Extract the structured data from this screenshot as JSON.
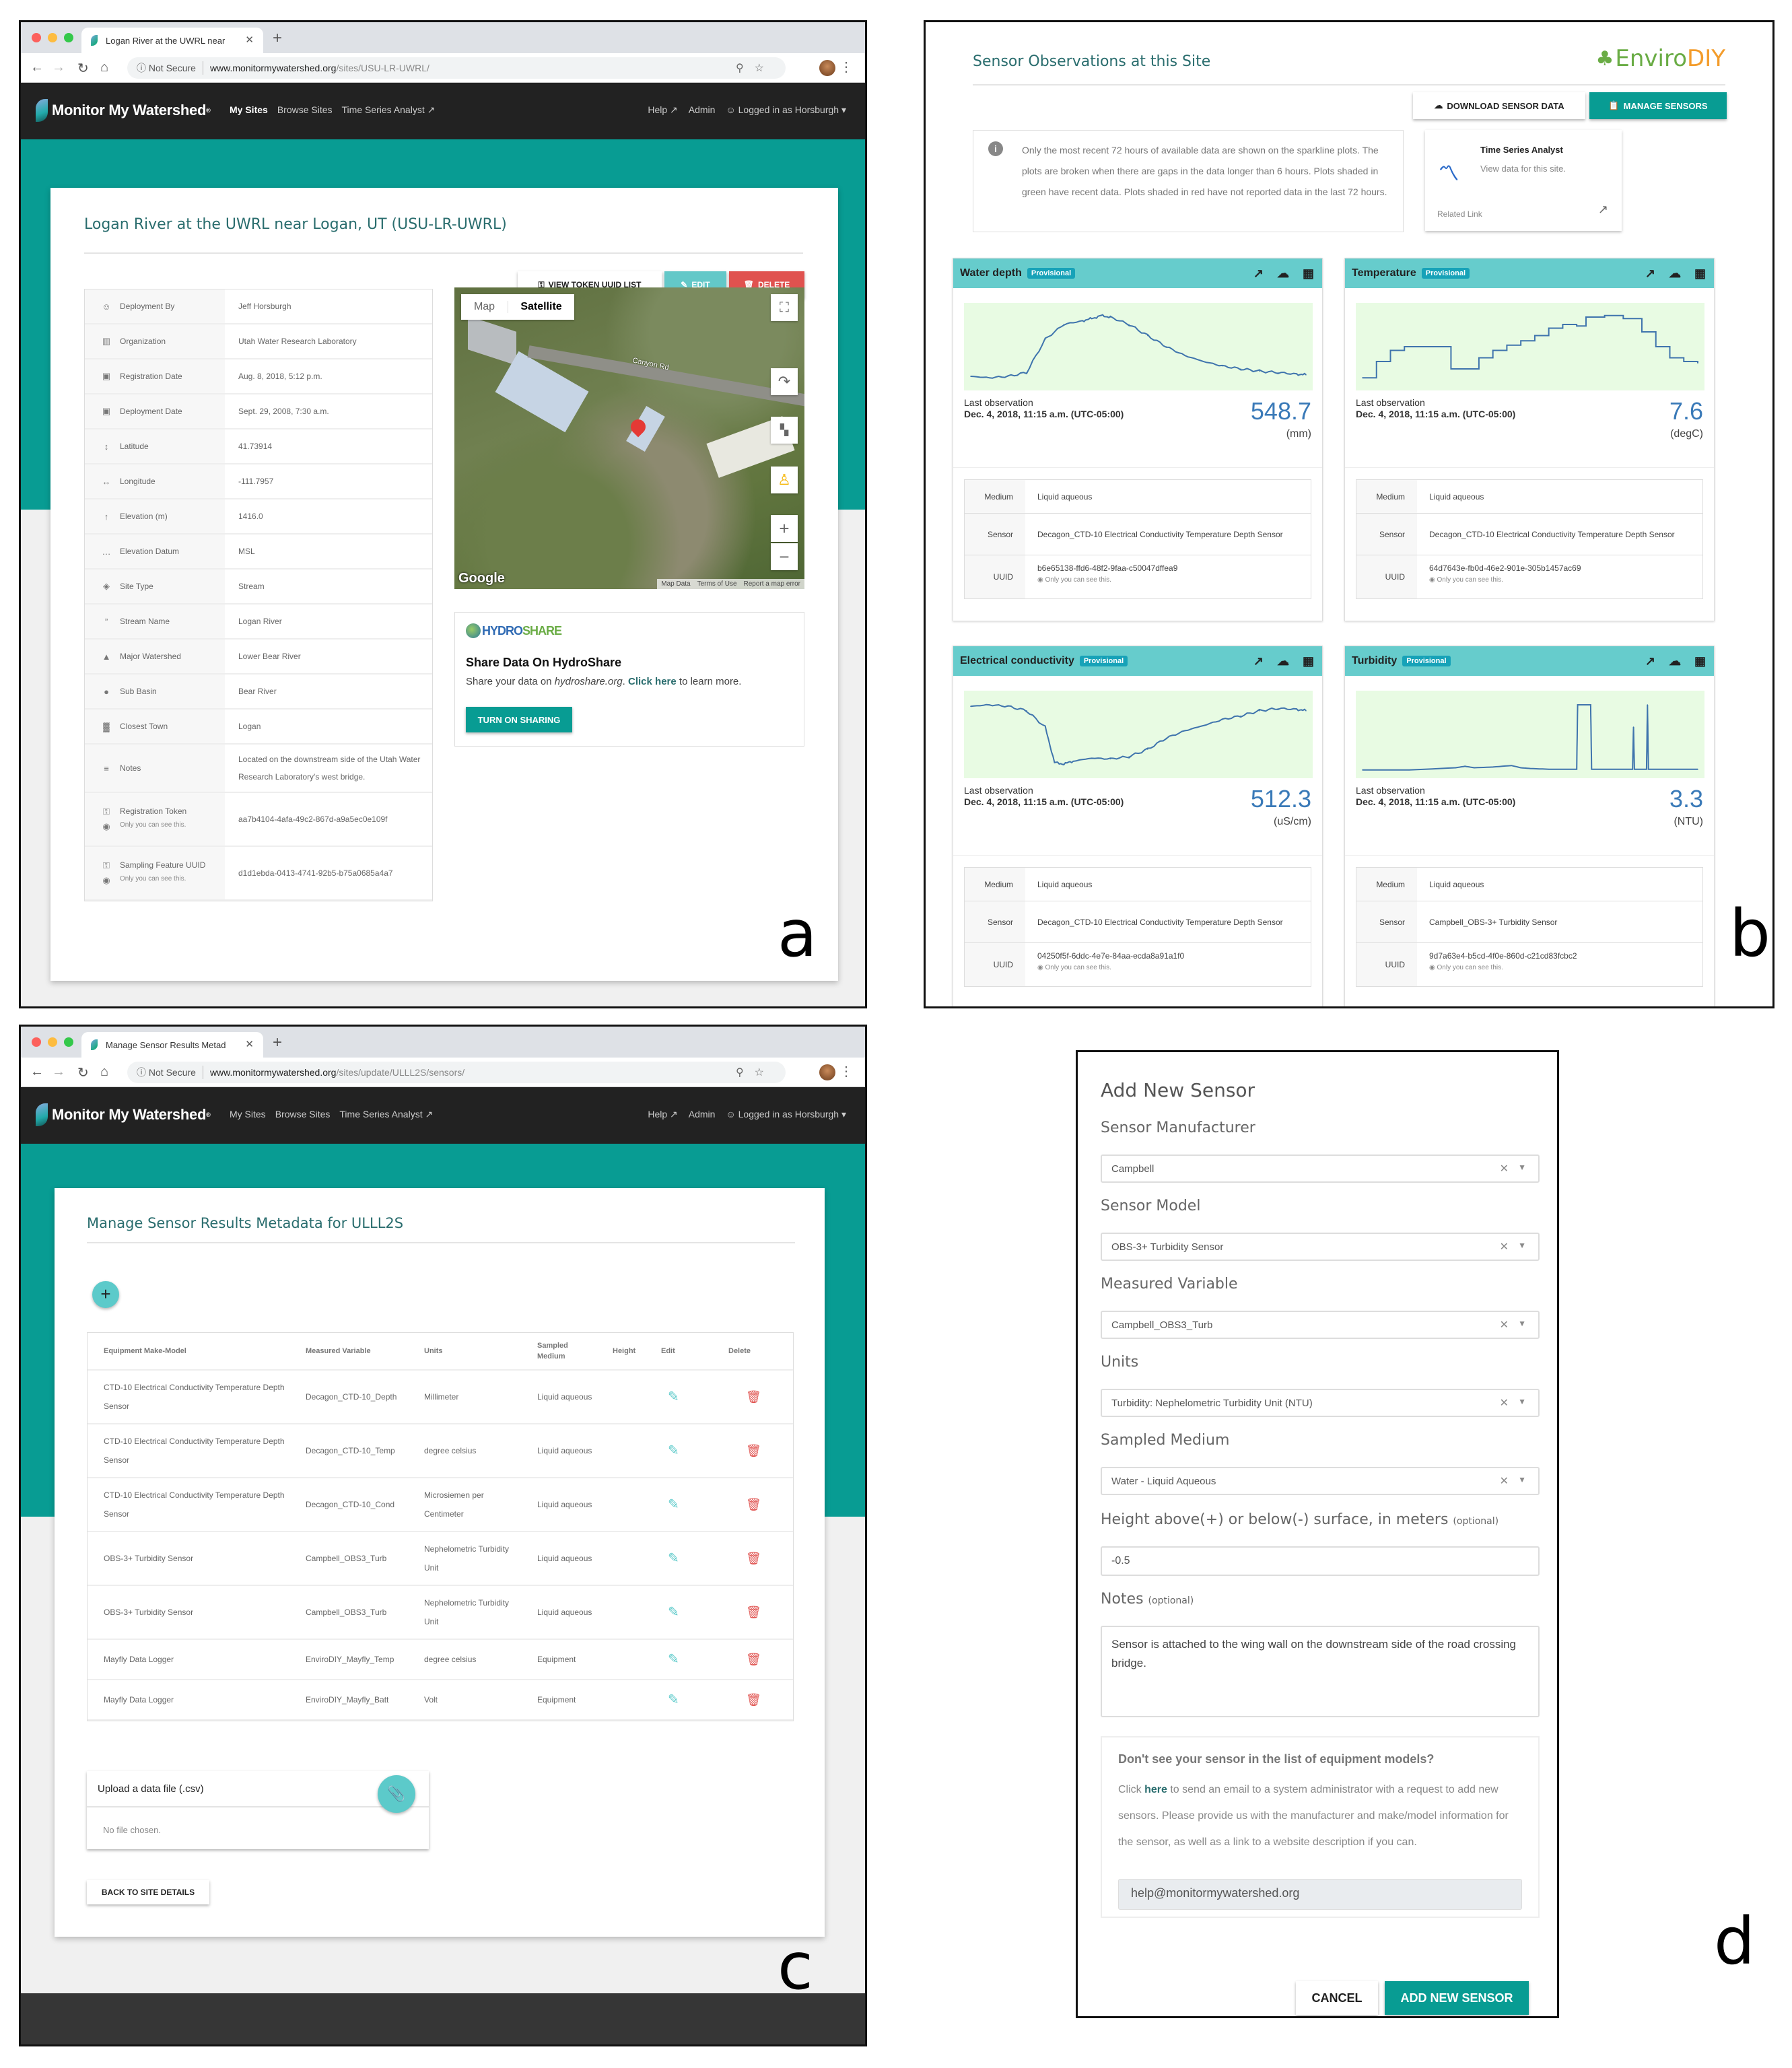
{
  "figure": {
    "labels": {
      "a": "a",
      "b": "b",
      "c": "c",
      "d": "d"
    }
  },
  "colors": {
    "brand_teal": "#089c93",
    "light_teal": "#66cccc",
    "danger": "#d9534f",
    "link_blue": "#3a7ab8",
    "spark_bg": "#e8fbe3",
    "nav_dark": "#222222"
  },
  "panel_a": {
    "browser": {
      "tab_title": "Logan River at the UWRL near",
      "security": "Not Secure",
      "url_host": "www.monitormywatershed.org",
      "url_path": "/sites/USU-LR-UWRL/"
    },
    "nav": {
      "brand": "Monitor My Watershed",
      "links": [
        "My Sites",
        "Browse Sites",
        "Time Series Analyst ↗"
      ],
      "right": [
        "Help ↗",
        "Admin",
        "☺ Logged in as Horsburgh ▾"
      ]
    },
    "title": "Logan River at the UWRL near Logan, UT (USU-LR-UWRL)",
    "buttons": {
      "token": "View Token UUID List",
      "edit": "Edit",
      "delete": "Delete"
    },
    "details": [
      {
        "icon": "user-icon",
        "glyph": "☺",
        "label": "Deployment By",
        "value": "Jeff Horsburgh"
      },
      {
        "icon": "building-icon",
        "glyph": "▥",
        "label": "Organization",
        "value": "Utah Water Research Laboratory"
      },
      {
        "icon": "calendar-icon",
        "glyph": "▣",
        "label": "Registration Date",
        "value": "Aug. 8, 2018, 5:12 p.m."
      },
      {
        "icon": "calendar-check-icon",
        "glyph": "▣",
        "label": "Deployment Date",
        "value": "Sept. 29, 2008, 7:30 a.m."
      },
      {
        "icon": "vertical-arrows-icon",
        "glyph": "↕",
        "label": "Latitude",
        "value": "41.73914"
      },
      {
        "icon": "horizontal-arrows-icon",
        "glyph": "↔",
        "label": "Longitude",
        "value": "-111.7957"
      },
      {
        "icon": "up-arrow-icon",
        "glyph": "↑",
        "label": "Elevation (m)",
        "value": "1416.0"
      },
      {
        "icon": "ellipsis-icon",
        "glyph": "…",
        "label": "Elevation Datum",
        "value": "MSL"
      },
      {
        "icon": "layers-icon",
        "glyph": "◈",
        "label": "Site Type",
        "value": "Stream"
      },
      {
        "icon": "quote-icon",
        "glyph": "”",
        "label": "Stream Name",
        "value": "Logan River"
      },
      {
        "icon": "mountains-icon",
        "glyph": "▲",
        "label": "Major Watershed",
        "value": "Lower Bear River"
      },
      {
        "icon": "circle-icon",
        "glyph": "●",
        "label": "Sub Basin",
        "value": "Bear River"
      },
      {
        "icon": "city-icon",
        "glyph": "▓",
        "label": "Closest Town",
        "value": "Logan"
      },
      {
        "icon": "notes-icon",
        "glyph": "≡",
        "label": "Notes",
        "value": "Located on the downstream side of the Utah Water Research Laboratory's west bridge."
      },
      {
        "icon": "key-icon",
        "glyph": "⚿",
        "label": "Registration Token",
        "note": "Only you can see this.",
        "value": "aa7b4104-4afa-49c2-867d-a9a5ec0e109f"
      },
      {
        "icon": "key-icon",
        "glyph": "⚿",
        "label": "Sampling Feature UUID",
        "note": "Only you can see this.",
        "value": "d1d1ebda-0413-4741-92b5-b75a0685a4a7"
      }
    ],
    "map": {
      "type_map": "Map",
      "type_satellite": "Satellite",
      "road_label": "Canyon Rd",
      "google": "Google",
      "footer": [
        "Map Data",
        "Terms of Use",
        "Report a map error"
      ]
    },
    "hydroshare": {
      "logo_a": "HYDRO",
      "logo_b": "SHARE",
      "heading": "Share Data On HydroShare",
      "text_pre": "Share your data on ",
      "text_em": "hydroshare.org",
      "text_mid": ". ",
      "link": "Click here",
      "text_post": " to learn more.",
      "button": "Turn On Sharing"
    }
  },
  "panel_b": {
    "title": "Sensor Observations at this Site",
    "logo_a": "Enviro",
    "logo_b": "DIY",
    "buttons": {
      "download": "Download Sensor Data",
      "manage": "Manage Sensors"
    },
    "info": "Only the most recent 72 hours of available data are shown on the sparkline plots. The plots are broken when there are gaps in the data longer than 6 hours. Plots shaded in green have recent data. Plots shaded in red have not reported data in the last 72 hours.",
    "tsa": {
      "title": "Time Series Analyst",
      "sub": "View data for this site.",
      "related": "Related Link"
    },
    "row_labels": {
      "medium": "Medium",
      "sensor": "Sensor",
      "uuid": "UUID",
      "last_obs": "Last observation",
      "only_you": "Only you can see this."
    },
    "sensors": [
      {
        "name": "Water depth",
        "badge": "Provisional",
        "date": "Dec. 4, 2018, 11:15 a.m. (UTC-05:00)",
        "value": "548.7",
        "unit": "(mm)",
        "medium": "Liquid aqueous",
        "sensor": "Decagon_CTD-10 Electrical Conductivity Temperature Depth Sensor",
        "uuid": "b6e65138-ffd6-48f2-9faa-c50047dffea9"
      },
      {
        "name": "Temperature",
        "badge": "Provisional",
        "date": "Dec. 4, 2018, 11:15 a.m. (UTC-05:00)",
        "value": "7.6",
        "unit": "(degC)",
        "medium": "Liquid aqueous",
        "sensor": "Decagon_CTD-10 Electrical Conductivity Temperature Depth Sensor",
        "uuid": "64d7643e-fb0d-46e2-901e-305b1457ac69"
      },
      {
        "name": "Electrical conductivity",
        "badge": "Provisional",
        "date": "Dec. 4, 2018, 11:15 a.m. (UTC-05:00)",
        "value": "512.3",
        "unit": "(uS/cm)",
        "medium": "Liquid aqueous",
        "sensor": "Decagon_CTD-10 Electrical Conductivity Temperature Depth Sensor",
        "uuid": "04250f5f-6ddc-4e7e-84aa-ecda8a91a1f0"
      },
      {
        "name": "Turbidity",
        "badge": "Provisional",
        "date": "Dec. 4, 2018, 11:15 a.m. (UTC-05:00)",
        "value": "3.3",
        "unit": "(NTU)",
        "medium": "Liquid aqueous",
        "sensor": "Campbell_OBS-3+ Turbidity Sensor",
        "uuid": "9d7a63e4-b5cd-4f0e-860d-c21cd83fcbc2"
      }
    ]
  },
  "chart_data": [
    {
      "type": "line",
      "title": "Water depth",
      "xlabel": "",
      "ylabel": "(mm)",
      "x": [
        0,
        4,
        8,
        12,
        16,
        20,
        24,
        26,
        28,
        30,
        34,
        38,
        42,
        46,
        50,
        54,
        58,
        62,
        66,
        70,
        72
      ],
      "values": [
        0.1,
        0.08,
        0.1,
        0.15,
        0.6,
        0.8,
        0.85,
        0.88,
        0.92,
        0.9,
        0.8,
        0.65,
        0.5,
        0.38,
        0.3,
        0.24,
        0.2,
        0.17,
        0.15,
        0.13,
        0.12
      ]
    },
    {
      "type": "line",
      "title": "Temperature",
      "xlabel": "",
      "ylabel": "(degC)",
      "x": [
        0,
        3,
        6,
        9,
        12,
        16,
        19,
        22,
        25,
        28,
        31,
        34,
        37,
        40,
        43,
        46,
        48,
        52,
        56,
        60,
        63,
        66,
        69,
        72
      ],
      "values": [
        0.08,
        0.3,
        0.45,
        0.5,
        0.5,
        0.5,
        0.2,
        0.2,
        0.35,
        0.45,
        0.52,
        0.58,
        0.65,
        0.75,
        0.8,
        0.78,
        0.9,
        0.92,
        0.88,
        0.7,
        0.5,
        0.35,
        0.3,
        0.28
      ]
    },
    {
      "type": "line",
      "title": "Electrical conductivity",
      "xlabel": "",
      "ylabel": "(uS/cm)",
      "x": [
        0,
        4,
        8,
        12,
        16,
        18,
        20,
        22,
        26,
        30,
        34,
        38,
        42,
        46,
        50,
        54,
        58,
        62,
        66,
        70,
        72
      ],
      "values": [
        0.88,
        0.9,
        0.88,
        0.82,
        0.6,
        0.12,
        0.1,
        0.14,
        0.18,
        0.17,
        0.2,
        0.3,
        0.45,
        0.55,
        0.62,
        0.7,
        0.75,
        0.82,
        0.85,
        0.84,
        0.82
      ]
    },
    {
      "type": "line",
      "title": "Turbidity",
      "xlabel": "",
      "ylabel": "(NTU)",
      "x": [
        0,
        10,
        20,
        22,
        24,
        28,
        32,
        34,
        36,
        40,
        46,
        46.2,
        49,
        49.2,
        58,
        58.2,
        58.4,
        61,
        61.2,
        61.4,
        72
      ],
      "values": [
        0.02,
        0.02,
        0.05,
        0.07,
        0.05,
        0.06,
        0.08,
        0.05,
        0.04,
        0.03,
        0.03,
        0.9,
        0.9,
        0.03,
        0.03,
        0.6,
        0.03,
        0.03,
        0.9,
        0.03,
        0.03
      ]
    }
  ],
  "panel_c": {
    "browser": {
      "tab_title": "Manage Sensor Results Metad",
      "security": "Not Secure",
      "url_host": "www.monitormywatershed.org",
      "url_path": "/sites/update/ULLL2S/sensors/"
    },
    "nav": {
      "brand": "Monitor My Watershed",
      "links": [
        "My Sites",
        "Browse Sites",
        "Time Series Analyst ↗"
      ],
      "right": [
        "Help ↗",
        "Admin",
        "☺ Logged in as Horsburgh ▾"
      ]
    },
    "title": "Manage Sensor Results Metadata for ULLL2S",
    "headers": [
      "Equipment Make-Model",
      "Measured Variable",
      "Units",
      "Sampled Medium",
      "Height",
      "Edit",
      "Delete"
    ],
    "rows": [
      {
        "model": "CTD-10 Electrical Conductivity Temperature Depth Sensor",
        "variable": "Decagon_CTD-10_Depth",
        "units": "Millimeter",
        "medium": "Liquid aqueous",
        "height": ""
      },
      {
        "model": "CTD-10 Electrical Conductivity Temperature Depth Sensor",
        "variable": "Decagon_CTD-10_Temp",
        "units": "degree celsius",
        "medium": "Liquid aqueous",
        "height": ""
      },
      {
        "model": "CTD-10 Electrical Conductivity Temperature Depth Sensor",
        "variable": "Decagon_CTD-10_Cond",
        "units": "Microsiemen per Centimeter",
        "medium": "Liquid aqueous",
        "height": ""
      },
      {
        "model": "OBS-3+ Turbidity Sensor",
        "variable": "Campbell_OBS3_Turb",
        "units": "Nephelometric Turbidity Unit",
        "medium": "Liquid aqueous",
        "height": ""
      },
      {
        "model": "OBS-3+ Turbidity Sensor",
        "variable": "Campbell_OBS3_Turb",
        "units": "Nephelometric Turbidity Unit",
        "medium": "Liquid aqueous",
        "height": ""
      },
      {
        "model": "Mayfly Data Logger",
        "variable": "EnviroDIY_Mayfly_Temp",
        "units": "degree celsius",
        "medium": "Equipment",
        "height": ""
      },
      {
        "model": "Mayfly Data Logger",
        "variable": "EnviroDIY_Mayfly_Batt",
        "units": "Volt",
        "medium": "Equipment",
        "height": ""
      }
    ],
    "upload": {
      "title": "Upload a data file (.csv)",
      "status": "No file chosen."
    },
    "back": "Back to Site Details"
  },
  "panel_d": {
    "title": "Add New Sensor",
    "fields": [
      {
        "label": "Sensor Manufacturer",
        "value": "Campbell"
      },
      {
        "label": "Sensor Model",
        "value": "OBS-3+ Turbidity Sensor"
      },
      {
        "label": "Measured Variable",
        "value": "Campbell_OBS3_Turb"
      },
      {
        "label": "Units",
        "value": "Turbidity: Nephelometric Turbidity Unit (NTU)"
      },
      {
        "label": "Sampled Medium",
        "value": "Water - Liquid Aqueous"
      }
    ],
    "height": {
      "label": "Height above(+) or below(-) surface, in meters",
      "optional": "(optional)",
      "value": "-0.5"
    },
    "notes": {
      "label": "Notes",
      "optional": "(optional)",
      "value": "Sensor is attached to the wing wall on the downstream side of the road crossing bridge."
    },
    "help": {
      "heading": "Don't see your sensor in the list of equipment models?",
      "pre": "Click ",
      "link": "here",
      "post": " to send an email to a system administrator with a request to add new sensors. Please provide us with the manufacturer and make/model information for the sensor, as well as a link to a website description if you can.",
      "email": "help@monitormywatershed.org"
    },
    "buttons": {
      "cancel": "Cancel",
      "add": "Add New Sensor"
    }
  }
}
